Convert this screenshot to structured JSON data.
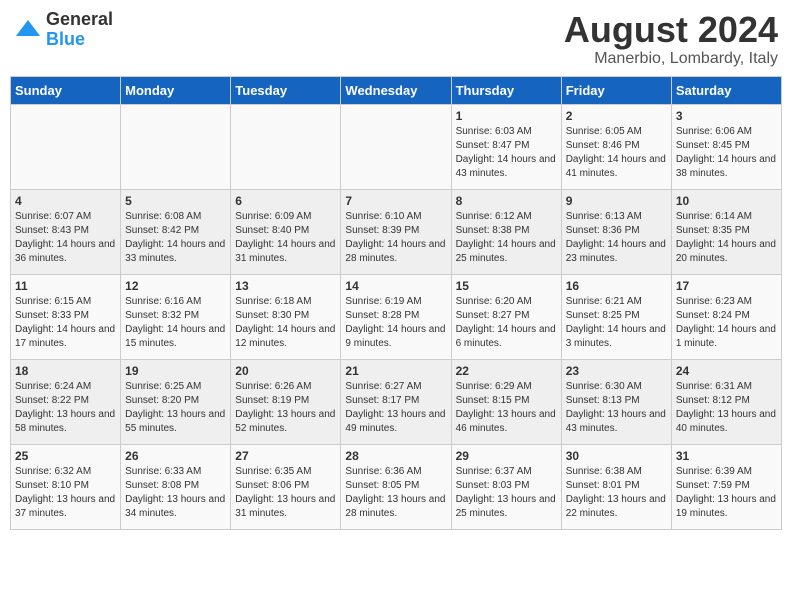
{
  "logo": {
    "general": "General",
    "blue": "Blue"
  },
  "header": {
    "month_year": "August 2024",
    "location": "Manerbio, Lombardy, Italy"
  },
  "days_of_week": [
    "Sunday",
    "Monday",
    "Tuesday",
    "Wednesday",
    "Thursday",
    "Friday",
    "Saturday"
  ],
  "weeks": [
    [
      {
        "day": "",
        "sunrise": "",
        "sunset": "",
        "daylight": ""
      },
      {
        "day": "",
        "sunrise": "",
        "sunset": "",
        "daylight": ""
      },
      {
        "day": "",
        "sunrise": "",
        "sunset": "",
        "daylight": ""
      },
      {
        "day": "",
        "sunrise": "",
        "sunset": "",
        "daylight": ""
      },
      {
        "day": "1",
        "sunrise": "Sunrise: 6:03 AM",
        "sunset": "Sunset: 8:47 PM",
        "daylight": "Daylight: 14 hours and 43 minutes."
      },
      {
        "day": "2",
        "sunrise": "Sunrise: 6:05 AM",
        "sunset": "Sunset: 8:46 PM",
        "daylight": "Daylight: 14 hours and 41 minutes."
      },
      {
        "day": "3",
        "sunrise": "Sunrise: 6:06 AM",
        "sunset": "Sunset: 8:45 PM",
        "daylight": "Daylight: 14 hours and 38 minutes."
      }
    ],
    [
      {
        "day": "4",
        "sunrise": "Sunrise: 6:07 AM",
        "sunset": "Sunset: 8:43 PM",
        "daylight": "Daylight: 14 hours and 36 minutes."
      },
      {
        "day": "5",
        "sunrise": "Sunrise: 6:08 AM",
        "sunset": "Sunset: 8:42 PM",
        "daylight": "Daylight: 14 hours and 33 minutes."
      },
      {
        "day": "6",
        "sunrise": "Sunrise: 6:09 AM",
        "sunset": "Sunset: 8:40 PM",
        "daylight": "Daylight: 14 hours and 31 minutes."
      },
      {
        "day": "7",
        "sunrise": "Sunrise: 6:10 AM",
        "sunset": "Sunset: 8:39 PM",
        "daylight": "Daylight: 14 hours and 28 minutes."
      },
      {
        "day": "8",
        "sunrise": "Sunrise: 6:12 AM",
        "sunset": "Sunset: 8:38 PM",
        "daylight": "Daylight: 14 hours and 25 minutes."
      },
      {
        "day": "9",
        "sunrise": "Sunrise: 6:13 AM",
        "sunset": "Sunset: 8:36 PM",
        "daylight": "Daylight: 14 hours and 23 minutes."
      },
      {
        "day": "10",
        "sunrise": "Sunrise: 6:14 AM",
        "sunset": "Sunset: 8:35 PM",
        "daylight": "Daylight: 14 hours and 20 minutes."
      }
    ],
    [
      {
        "day": "11",
        "sunrise": "Sunrise: 6:15 AM",
        "sunset": "Sunset: 8:33 PM",
        "daylight": "Daylight: 14 hours and 17 minutes."
      },
      {
        "day": "12",
        "sunrise": "Sunrise: 6:16 AM",
        "sunset": "Sunset: 8:32 PM",
        "daylight": "Daylight: 14 hours and 15 minutes."
      },
      {
        "day": "13",
        "sunrise": "Sunrise: 6:18 AM",
        "sunset": "Sunset: 8:30 PM",
        "daylight": "Daylight: 14 hours and 12 minutes."
      },
      {
        "day": "14",
        "sunrise": "Sunrise: 6:19 AM",
        "sunset": "Sunset: 8:28 PM",
        "daylight": "Daylight: 14 hours and 9 minutes."
      },
      {
        "day": "15",
        "sunrise": "Sunrise: 6:20 AM",
        "sunset": "Sunset: 8:27 PM",
        "daylight": "Daylight: 14 hours and 6 minutes."
      },
      {
        "day": "16",
        "sunrise": "Sunrise: 6:21 AM",
        "sunset": "Sunset: 8:25 PM",
        "daylight": "Daylight: 14 hours and 3 minutes."
      },
      {
        "day": "17",
        "sunrise": "Sunrise: 6:23 AM",
        "sunset": "Sunset: 8:24 PM",
        "daylight": "Daylight: 14 hours and 1 minute."
      }
    ],
    [
      {
        "day": "18",
        "sunrise": "Sunrise: 6:24 AM",
        "sunset": "Sunset: 8:22 PM",
        "daylight": "Daylight: 13 hours and 58 minutes."
      },
      {
        "day": "19",
        "sunrise": "Sunrise: 6:25 AM",
        "sunset": "Sunset: 8:20 PM",
        "daylight": "Daylight: 13 hours and 55 minutes."
      },
      {
        "day": "20",
        "sunrise": "Sunrise: 6:26 AM",
        "sunset": "Sunset: 8:19 PM",
        "daylight": "Daylight: 13 hours and 52 minutes."
      },
      {
        "day": "21",
        "sunrise": "Sunrise: 6:27 AM",
        "sunset": "Sunset: 8:17 PM",
        "daylight": "Daylight: 13 hours and 49 minutes."
      },
      {
        "day": "22",
        "sunrise": "Sunrise: 6:29 AM",
        "sunset": "Sunset: 8:15 PM",
        "daylight": "Daylight: 13 hours and 46 minutes."
      },
      {
        "day": "23",
        "sunrise": "Sunrise: 6:30 AM",
        "sunset": "Sunset: 8:13 PM",
        "daylight": "Daylight: 13 hours and 43 minutes."
      },
      {
        "day": "24",
        "sunrise": "Sunrise: 6:31 AM",
        "sunset": "Sunset: 8:12 PM",
        "daylight": "Daylight: 13 hours and 40 minutes."
      }
    ],
    [
      {
        "day": "25",
        "sunrise": "Sunrise: 6:32 AM",
        "sunset": "Sunset: 8:10 PM",
        "daylight": "Daylight: 13 hours and 37 minutes."
      },
      {
        "day": "26",
        "sunrise": "Sunrise: 6:33 AM",
        "sunset": "Sunset: 8:08 PM",
        "daylight": "Daylight: 13 hours and 34 minutes."
      },
      {
        "day": "27",
        "sunrise": "Sunrise: 6:35 AM",
        "sunset": "Sunset: 8:06 PM",
        "daylight": "Daylight: 13 hours and 31 minutes."
      },
      {
        "day": "28",
        "sunrise": "Sunrise: 6:36 AM",
        "sunset": "Sunset: 8:05 PM",
        "daylight": "Daylight: 13 hours and 28 minutes."
      },
      {
        "day": "29",
        "sunrise": "Sunrise: 6:37 AM",
        "sunset": "Sunset: 8:03 PM",
        "daylight": "Daylight: 13 hours and 25 minutes."
      },
      {
        "day": "30",
        "sunrise": "Sunrise: 6:38 AM",
        "sunset": "Sunset: 8:01 PM",
        "daylight": "Daylight: 13 hours and 22 minutes."
      },
      {
        "day": "31",
        "sunrise": "Sunrise: 6:39 AM",
        "sunset": "Sunset: 7:59 PM",
        "daylight": "Daylight: 13 hours and 19 minutes."
      }
    ]
  ]
}
